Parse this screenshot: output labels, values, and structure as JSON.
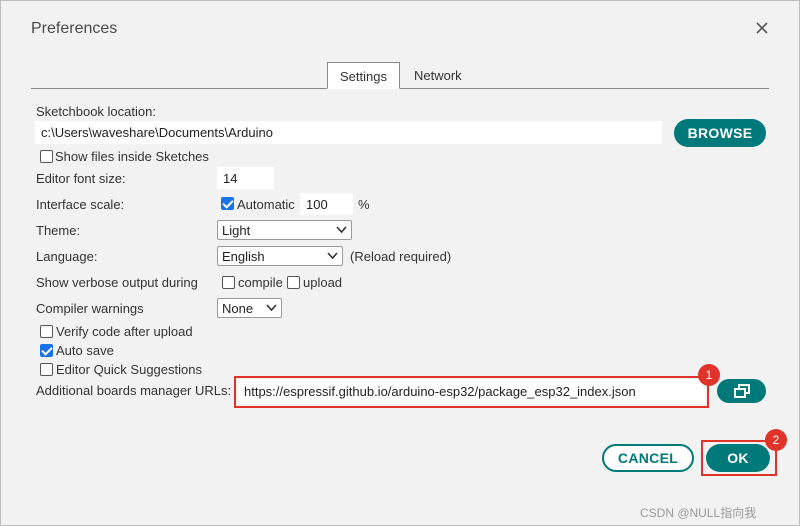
{
  "dialog": {
    "title": "Preferences"
  },
  "tabs": {
    "settings": "Settings",
    "network": "Network"
  },
  "sketchbook": {
    "label": "Sketchbook location:",
    "path": "c:\\Users\\waveshare\\Documents\\Arduino",
    "browse": "BROWSE",
    "show_files": "Show inside Sketches",
    "show_files_label": "Show files inside Sketches"
  },
  "font_size": {
    "label": "Editor font size:",
    "value": "14"
  },
  "interface_scale": {
    "label": "Interface scale:",
    "automatic": "Automatic",
    "value": "100",
    "unit": "%"
  },
  "theme": {
    "label": "Theme:",
    "selected": "Light"
  },
  "language": {
    "label": "Language:",
    "selected": "English",
    "note": "(Reload required)"
  },
  "verbose": {
    "label": "Show verbose output during",
    "compile": "compile",
    "upload": "upload"
  },
  "compiler_warnings": {
    "label": "Compiler warnings",
    "selected": "None"
  },
  "options": {
    "verify": "Verify code after upload",
    "autosave": "Auto save",
    "quick_suggestions": "Editor Quick Suggestions"
  },
  "boards_urls": {
    "label": "Additional boards manager URLs:",
    "value": "https://espressif.github.io/arduino-esp32/package_esp32_index.json"
  },
  "annotations": {
    "badge1": "1",
    "badge2": "2"
  },
  "footer": {
    "cancel": "CANCEL",
    "ok": "OK",
    "watermark": "CSDN @NULL指向我"
  },
  "colors": {
    "accent": "#00797b",
    "highlight": "#e0342b",
    "checkbox": "#1a73e8"
  },
  "icons": {
    "close": "close-icon",
    "open_window": "open-window-icon"
  }
}
